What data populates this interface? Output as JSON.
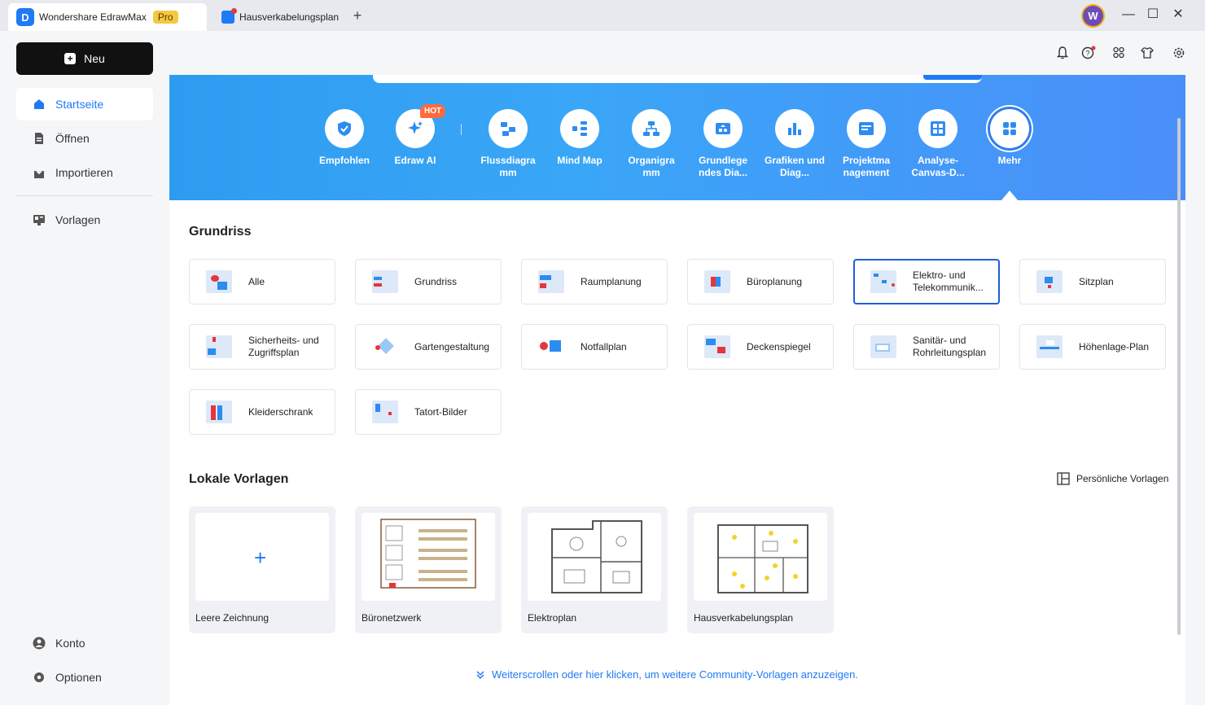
{
  "titlebar": {
    "app_name": "Wondershare EdrawMax",
    "pro_label": "Pro",
    "doc_tab": "Hausverkabelungsplan",
    "avatar_letter": "W",
    "new_tab": "+",
    "minimize": "—",
    "maximize": "☐",
    "close": "✕"
  },
  "sidebar": {
    "new_label": "Neu",
    "items": [
      {
        "label": "Startseite",
        "icon": "home-icon"
      },
      {
        "label": "Öffnen",
        "icon": "file-icon"
      },
      {
        "label": "Importieren",
        "icon": "import-icon"
      },
      {
        "label": "Vorlagen",
        "icon": "templates-icon"
      },
      {
        "label": "Konto",
        "icon": "account-icon"
      },
      {
        "label": "Optionen",
        "icon": "settings-icon"
      }
    ]
  },
  "categories": [
    {
      "label": "Empfohlen",
      "icon": "recommended-icon"
    },
    {
      "label": "Edraw AI",
      "icon": "ai-sparkle-icon",
      "badge": "HOT"
    },
    {
      "label": "Flussdiagra mm",
      "icon": "flowchart-icon"
    },
    {
      "label": "Mind Map",
      "icon": "mindmap-icon"
    },
    {
      "label": "Organigra mm",
      "icon": "orgchart-icon"
    },
    {
      "label": "Grundlege ndes Dia...",
      "icon": "basic-diagram-icon"
    },
    {
      "label": "Grafiken und Diag...",
      "icon": "graphs-icon"
    },
    {
      "label": "Projektma nagement",
      "icon": "project-icon"
    },
    {
      "label": "Analyse- Canvas-D...",
      "icon": "canvas-icon"
    },
    {
      "label": "Mehr",
      "icon": "more-grid-icon"
    }
  ],
  "grundriss": {
    "title": "Grundriss",
    "items": [
      "Alle",
      "Grundriss",
      "Raumplanung",
      "Büroplanung",
      "Elektro- und Telekommunik...",
      "Sitzplan",
      "Sicherheits- und Zugriffsplan",
      "Gartengestaltung",
      "Notfallplan",
      "Deckenspiegel",
      "Sanitär- und Rohrleitungsplan",
      "Höhenlage-Plan",
      "Kleiderschrank",
      "Tatort-Bilder"
    ],
    "selected_index": 4
  },
  "local": {
    "title": "Lokale Vorlagen",
    "personal_label": "Persönliche Vorlagen",
    "items": [
      "Leere Zeichnung",
      "Büronetzwerk",
      "Elektroplan",
      "Hausverkabelungsplan"
    ],
    "plus": "+"
  },
  "more_link": "Weiterscrollen oder hier klicken, um weitere Community-Vorlagen anzuzeigen.",
  "colors": {
    "accent": "#1f7af5",
    "banner_start": "#2d9cf0",
    "banner_end": "#4a8ff9",
    "hot": "#ff6a3d",
    "pro": "#f5c842"
  }
}
